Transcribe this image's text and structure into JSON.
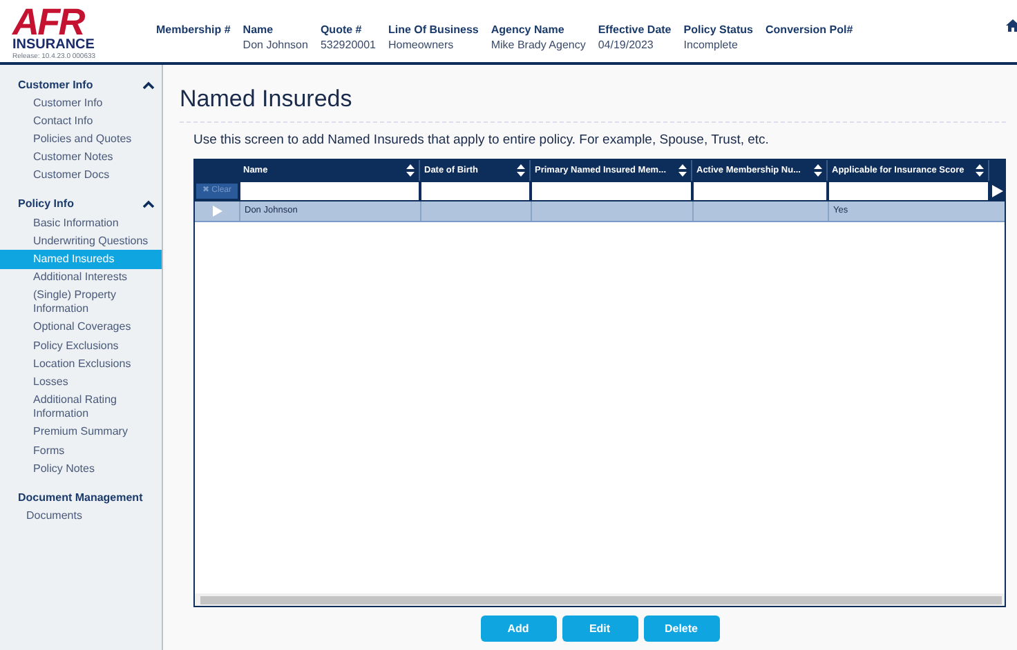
{
  "logo": {
    "letters": "AFR",
    "word": "INSURANCE",
    "release": "Release: 10.4.23.0 000633"
  },
  "header_fields": [
    {
      "label": "Membership #"
    },
    {
      "label": "Name",
      "value": "Don Johnson"
    },
    {
      "label": "Quote #",
      "value": "532920001"
    },
    {
      "label": "Line Of Business",
      "value": "Homeowners"
    },
    {
      "label": "Agency Name",
      "value": "Mike Brady Agency"
    },
    {
      "label": "Effective Date",
      "value": "04/19/2023"
    },
    {
      "label": "Policy Status",
      "value": "Incomplete"
    },
    {
      "label": "Conversion Pol#"
    }
  ],
  "sidebar": {
    "sections": [
      {
        "title": "Customer Info",
        "expanded": true,
        "items": [
          {
            "label": "Customer Info",
            "selected": false
          },
          {
            "label": "Contact Info",
            "selected": false
          },
          {
            "label": "Policies and Quotes",
            "selected": false
          },
          {
            "label": "Customer Notes",
            "selected": false
          },
          {
            "label": "Customer Docs",
            "selected": false
          }
        ]
      },
      {
        "title": "Policy Info",
        "expanded": true,
        "items": [
          {
            "label": "Basic Information",
            "selected": false
          },
          {
            "label": "Underwriting Questions",
            "selected": false
          },
          {
            "label": "Named Insureds",
            "selected": true
          },
          {
            "label": "Additional Interests",
            "selected": false
          },
          {
            "label": "(Single) Property Information",
            "selected": false
          },
          {
            "label": "Optional Coverages",
            "selected": false
          },
          {
            "label": "Policy Exclusions",
            "selected": false
          },
          {
            "label": "Location Exclusions",
            "selected": false
          },
          {
            "label": "Losses",
            "selected": false
          },
          {
            "label": "Additional Rating Information",
            "selected": false
          },
          {
            "label": "Premium Summary",
            "selected": false
          },
          {
            "label": "Forms",
            "selected": false
          },
          {
            "label": "Policy Notes",
            "selected": false
          }
        ]
      },
      {
        "title": "Document Management",
        "items": [
          {
            "label": "Documents",
            "selected": false
          }
        ]
      }
    ]
  },
  "page_title": "Named Insureds",
  "description": "Use this screen to add Named Insureds that apply to entire policy. For example, Spouse, Trust, etc.",
  "table": {
    "clear_label": "✖ Clear",
    "columns": [
      "Name",
      "Date of Birth",
      "Primary Named Insured Mem...",
      "Active Membership Nu...",
      "Applicable for Insurance Score"
    ],
    "rows": [
      {
        "selected": true,
        "cells": [
          "Don Johnson",
          "",
          "",
          "",
          "Yes"
        ]
      }
    ]
  },
  "buttons": [
    "Add",
    "Edit",
    "Delete"
  ]
}
